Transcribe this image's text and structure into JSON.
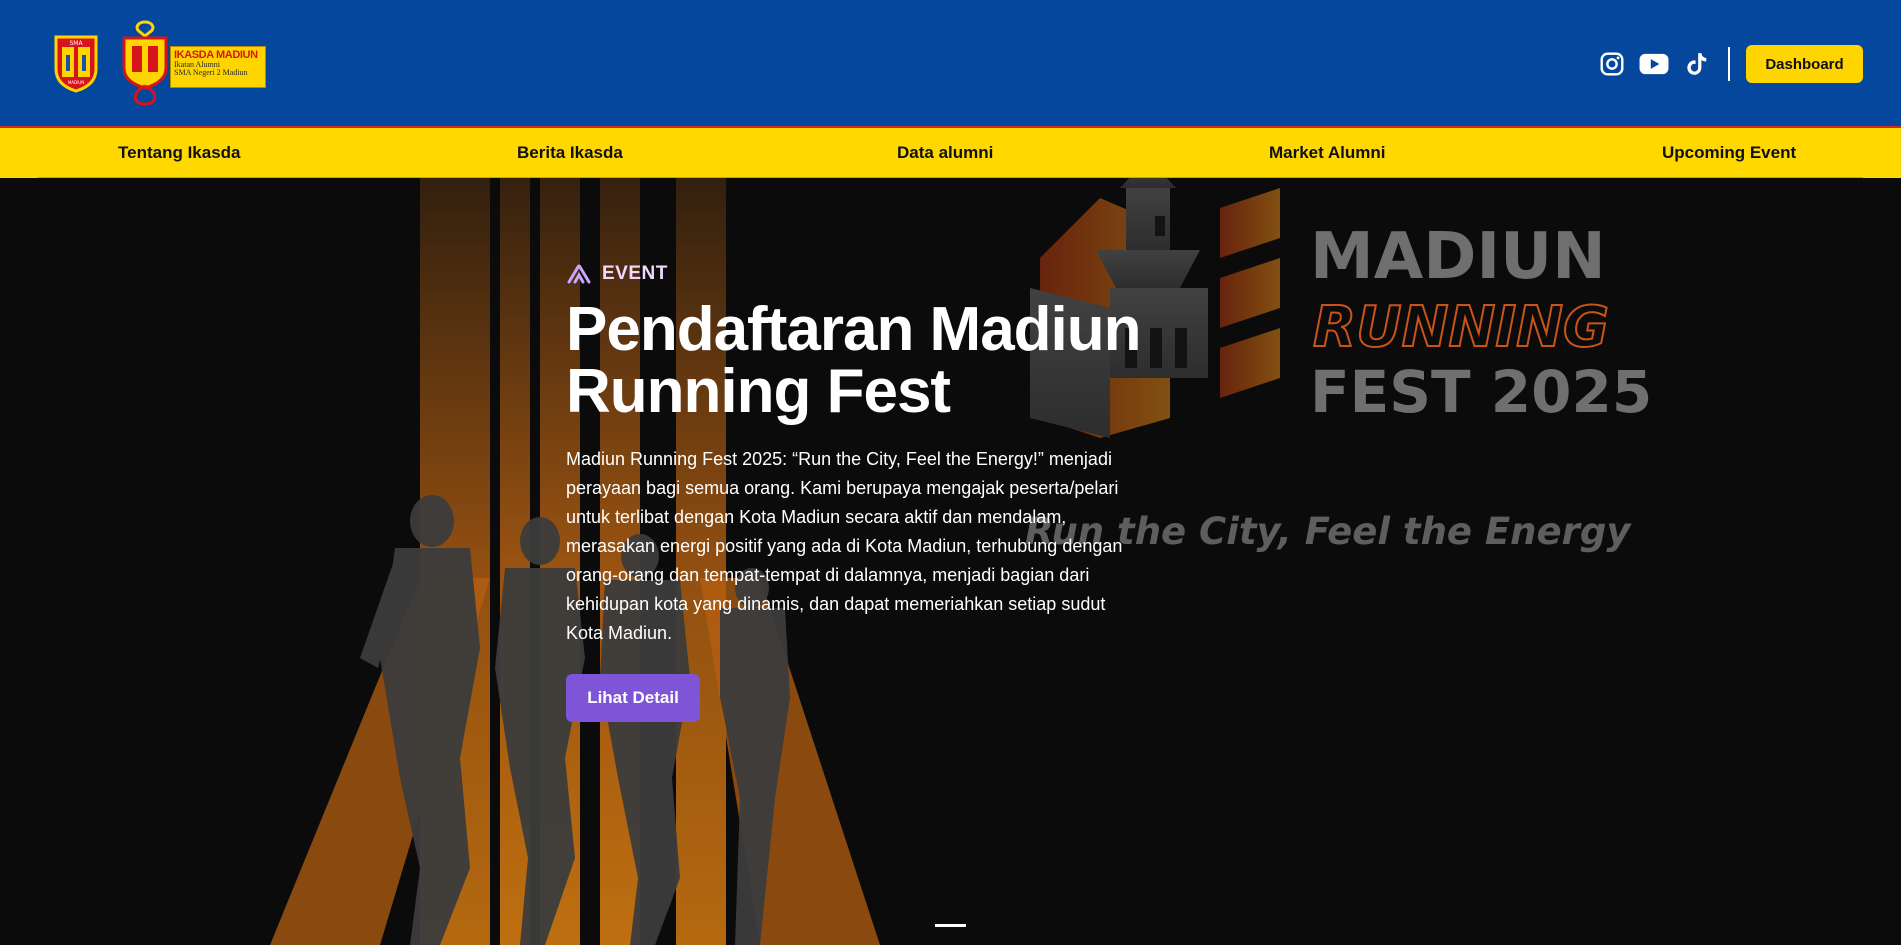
{
  "brand": {
    "logo1_text": "SMA",
    "logo1_sub": "MADIUN",
    "name": "IKASDA MADIUN",
    "tagline_line1": "Ikatan Alumni",
    "tagline_line2": "SMA Negeri 2 Madiun"
  },
  "header": {
    "social_icons": [
      "instagram-icon",
      "youtube-icon",
      "tiktok-icon"
    ],
    "dashboard_label": "Dashboard"
  },
  "nav": {
    "items": [
      {
        "label": "Tentang Ikasda"
      },
      {
        "label": "Berita Ikasda"
      },
      {
        "label": "Data alumni"
      },
      {
        "label": "Market Alumni"
      },
      {
        "label": "Upcoming Event"
      }
    ]
  },
  "hero": {
    "eyebrow": "EVENT",
    "title": "Pendaftaran Madiun Running Fest",
    "description": "Madiun Running Fest 2025: “Run the City, Feel the Energy!” menjadi perayaan bagi semua orang. Kami berupaya mengajak peserta/pelari untuk terlibat dengan Kota Madiun secara aktif dan mendalam, merasakan energi positif yang ada di Kota Madiun, terhubung dengan orang-orang dan tempat-tempat di dalamnya, menjadi bagian dari kehidupan kota yang dinamis, dan dapat memeriahkan setiap sudut Kota Madiun.",
    "button_label": "Lihat Detail",
    "poster": {
      "line1": "MADIUN",
      "line2": "RUNNING",
      "line3": "FEST 2025",
      "tagline": "Run the City, Feel the Energy"
    }
  },
  "colors": {
    "header_bg": "#05479c",
    "nav_bg": "#ffd800",
    "accent_button": "#7d55d6",
    "dashboard_button": "#ffd500"
  }
}
